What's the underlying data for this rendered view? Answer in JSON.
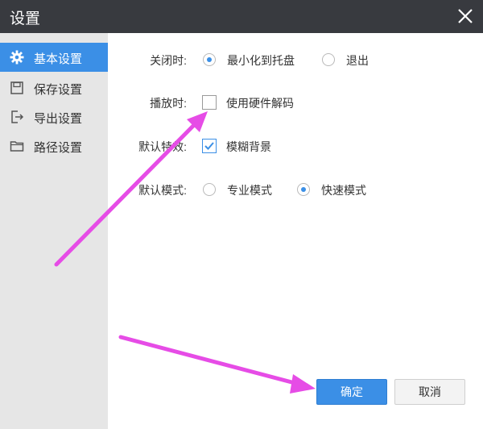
{
  "window": {
    "title": "设置"
  },
  "sidebar": {
    "items": [
      {
        "label": "基本设置",
        "icon": "gear-icon",
        "active": true
      },
      {
        "label": "保存设置",
        "icon": "save-icon",
        "active": false
      },
      {
        "label": "导出设置",
        "icon": "export-icon",
        "active": false
      },
      {
        "label": "路径设置",
        "icon": "folder-icon",
        "active": false
      }
    ]
  },
  "settings": {
    "close_behavior": {
      "label": "关闭时:",
      "options": [
        {
          "label": "最小化到托盘",
          "selected": true
        },
        {
          "label": "退出",
          "selected": false
        }
      ]
    },
    "playback": {
      "label": "播放时:",
      "option": {
        "label": "使用硬件解码",
        "checked": false
      }
    },
    "default_effect": {
      "label": "默认特效:",
      "option": {
        "label": "模糊背景",
        "checked": true
      }
    },
    "default_mode": {
      "label": "默认模式:",
      "options": [
        {
          "label": "专业模式",
          "selected": false
        },
        {
          "label": "快速模式",
          "selected": true
        }
      ]
    }
  },
  "buttons": {
    "ok": "确定",
    "cancel": "取消"
  },
  "colors": {
    "accent": "#3b8fe6",
    "titlebar": "#383a3f",
    "sidebar": "#e6e6e6",
    "annotation": "#e64ce6"
  }
}
